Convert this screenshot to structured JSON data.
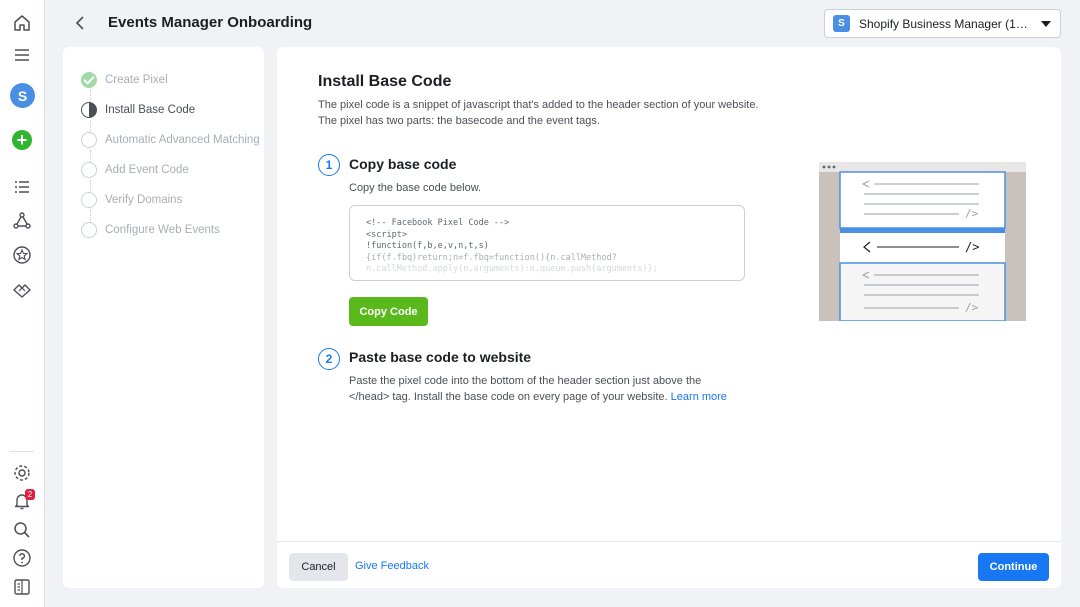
{
  "header": {
    "title": "Events Manager Onboarding",
    "business_select": {
      "badge": "S",
      "label": "Shopify Business Manager (1680..."
    }
  },
  "rail": {
    "avatar_letter": "S",
    "plus_symbol": "+",
    "notification_count": "2"
  },
  "stepper": {
    "steps": [
      {
        "label": "Create Pixel",
        "state": "done"
      },
      {
        "label": "Install Base Code",
        "state": "active"
      },
      {
        "label": "Automatic Advanced Matching",
        "state": "pending"
      },
      {
        "label": "Add Event Code",
        "state": "pending"
      },
      {
        "label": "Verify Domains",
        "state": "pending"
      },
      {
        "label": "Configure Web Events",
        "state": "pending"
      }
    ]
  },
  "main": {
    "title": "Install Base Code",
    "description_line1": "The pixel code is a snippet of javascript that's added to the header section of your website.",
    "description_line2": "The pixel has two parts: the basecode and the event tags.",
    "step1": {
      "number": "1",
      "title": "Copy base code",
      "subtitle": "Copy the base code below.",
      "code_lines": [
        "<!-- Facebook Pixel Code -->",
        "<script>",
        "!function(f,b,e,v,n,t,s)",
        "{if(f.fbq)return;n=f.fbq=function(){n.callMethod?",
        "n.callMethod.apply(n,arguments):n.queue.push(arguments)};"
      ],
      "copy_button": "Copy Code"
    },
    "step2": {
      "number": "2",
      "title": "Paste base code to website",
      "text_line1": "Paste the pixel code into the bottom of the header section just above the",
      "text_line2": "</head> tag. Install the base code on every page of your website.",
      "learn_more": "Learn more"
    }
  },
  "illustration": {
    "code_glyph_small": "/>",
    "code_glyph_open": "<",
    "code_glyph_close": "/>"
  },
  "footer": {
    "cancel": "Cancel",
    "feedback": "Give Feedback",
    "continue": "Continue"
  },
  "colors": {
    "primary_blue": "#1877f2",
    "copy_green": "#59b81a",
    "done_green": "#a3d9a5",
    "badge_red": "#e41e3f"
  }
}
